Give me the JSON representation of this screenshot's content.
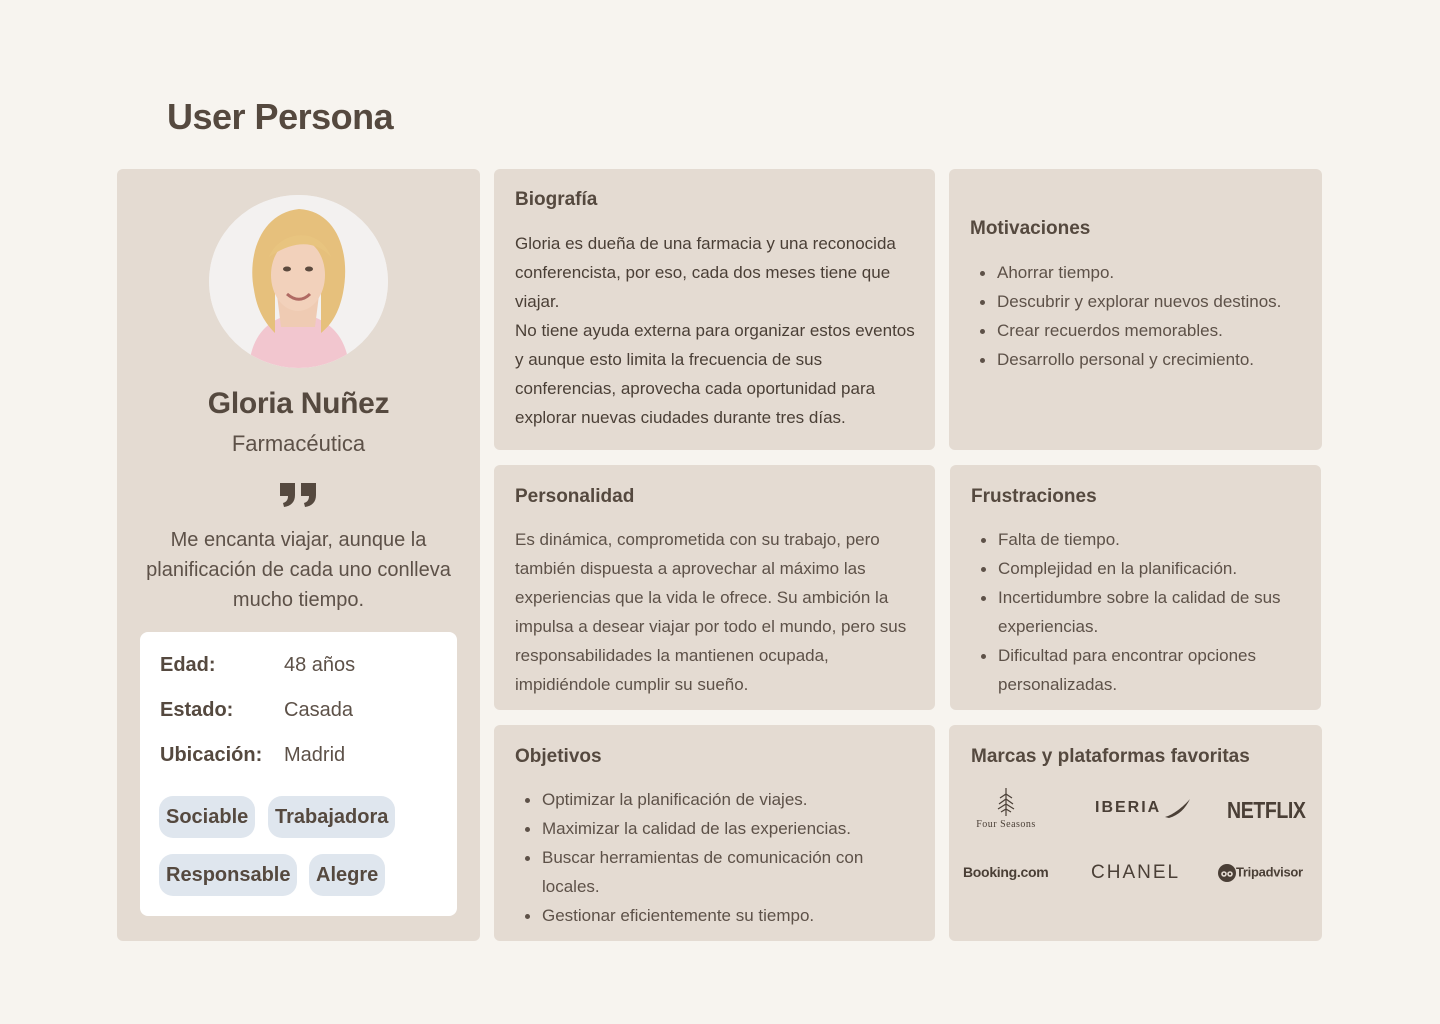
{
  "page_title": "User Persona",
  "profile": {
    "name": "Gloria Nuñez",
    "role": "Farmacéutica",
    "quote": "Me  encanta viajar, aunque la planificación de cada uno conlleva mucho tiempo.",
    "facts": [
      {
        "label": "Edad:",
        "value": "48 años"
      },
      {
        "label": "Estado:",
        "value": "Casada"
      },
      {
        "label": "Ubicación:",
        "value": "Madrid"
      }
    ],
    "tags": [
      "Sociable",
      "Trabajadora",
      "Responsable",
      "Alegre"
    ]
  },
  "biografia": {
    "title": "Biografía",
    "paragraphs": [
      "Gloria es dueña de una farmacia y una reconocida conferencista, por eso, cada dos meses tiene que viajar.",
      "No tiene ayuda externa para organizar estos eventos y aunque esto limita la frecuencia de sus conferencias, aprovecha cada oportunidad para explorar nuevas ciudades durante tres días."
    ]
  },
  "motivaciones": {
    "title": "Motivaciones",
    "items": [
      "Ahorrar tiempo.",
      "Descubrir y explorar nuevos destinos.",
      "Crear recuerdos memorables.",
      "Desarrollo personal y crecimiento."
    ]
  },
  "personalidad": {
    "title": "Personalidad",
    "text": "Es dinámica, comprometida con su trabajo, pero también dispuesta a aprovechar al máximo las experiencias que la vida le ofrece. Su ambición la impulsa a desear viajar por todo el mundo, pero sus responsabilidades la mantienen ocupada, impidiéndole cumplir su sueño."
  },
  "frustraciones": {
    "title": "Frustraciones",
    "items": [
      "Falta de tiempo.",
      "Complejidad en la planificación.",
      "Incertidumbre sobre la calidad de sus experiencias.",
      "Dificultad para encontrar opciones personalizadas."
    ]
  },
  "objetivos": {
    "title": "Objetivos",
    "items": [
      "Optimizar la planificación de viajes.",
      "Maximizar la calidad de las experiencias.",
      "Buscar herramientas de comunicación con locales.",
      "Gestionar eficientemente su tiempo."
    ]
  },
  "marcas": {
    "title": "Marcas y plataformas favoritas",
    "logos": {
      "four_seasons": "Four Seasons",
      "iberia": "IBERIA",
      "netflix": "NETFLIX",
      "booking": "Booking.com",
      "chanel": "CHANEL",
      "tripadvisor": "Tripadvisor"
    }
  },
  "colors": {
    "background": "#f7f4ef",
    "card": "#e4dbd2",
    "text": "#55493f",
    "tag": "#dfe6ee"
  },
  "icons": [
    "quote-icon",
    "four-seasons-tree-icon",
    "iberia-wing-icon",
    "tripadvisor-owl-icon"
  ]
}
